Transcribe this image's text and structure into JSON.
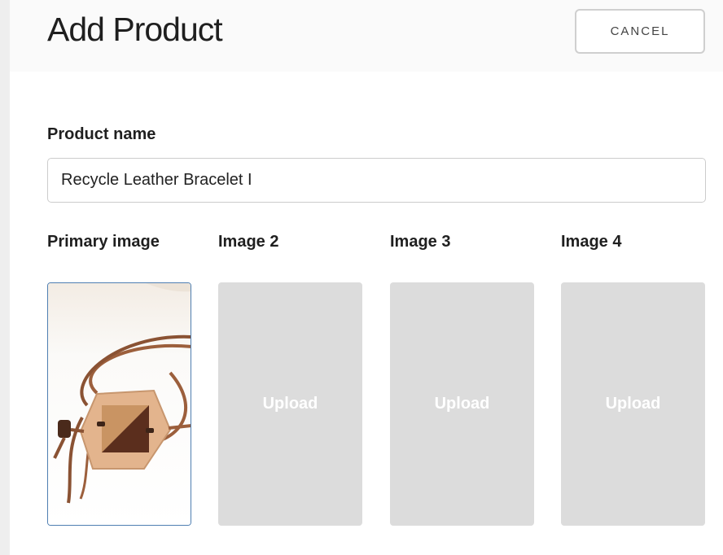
{
  "header": {
    "title": "Add Product",
    "cancel_label": "CANCEL"
  },
  "form": {
    "product_name_label": "Product name",
    "product_name_value": "Recycle Leather Bracelet I"
  },
  "images": {
    "slots": [
      {
        "label": "Primary image",
        "state": "filled",
        "content": "leather-bracelet-photo"
      },
      {
        "label": "Image 2",
        "state": "empty",
        "upload_label": "Upload"
      },
      {
        "label": "Image 3",
        "state": "empty",
        "upload_label": "Upload"
      },
      {
        "label": "Image 4",
        "state": "empty",
        "upload_label": "Upload"
      }
    ]
  },
  "colors": {
    "selected_border": "#4f7fb2",
    "empty_slot_bg": "#dcdcdc",
    "header_bg": "#fafafa"
  }
}
